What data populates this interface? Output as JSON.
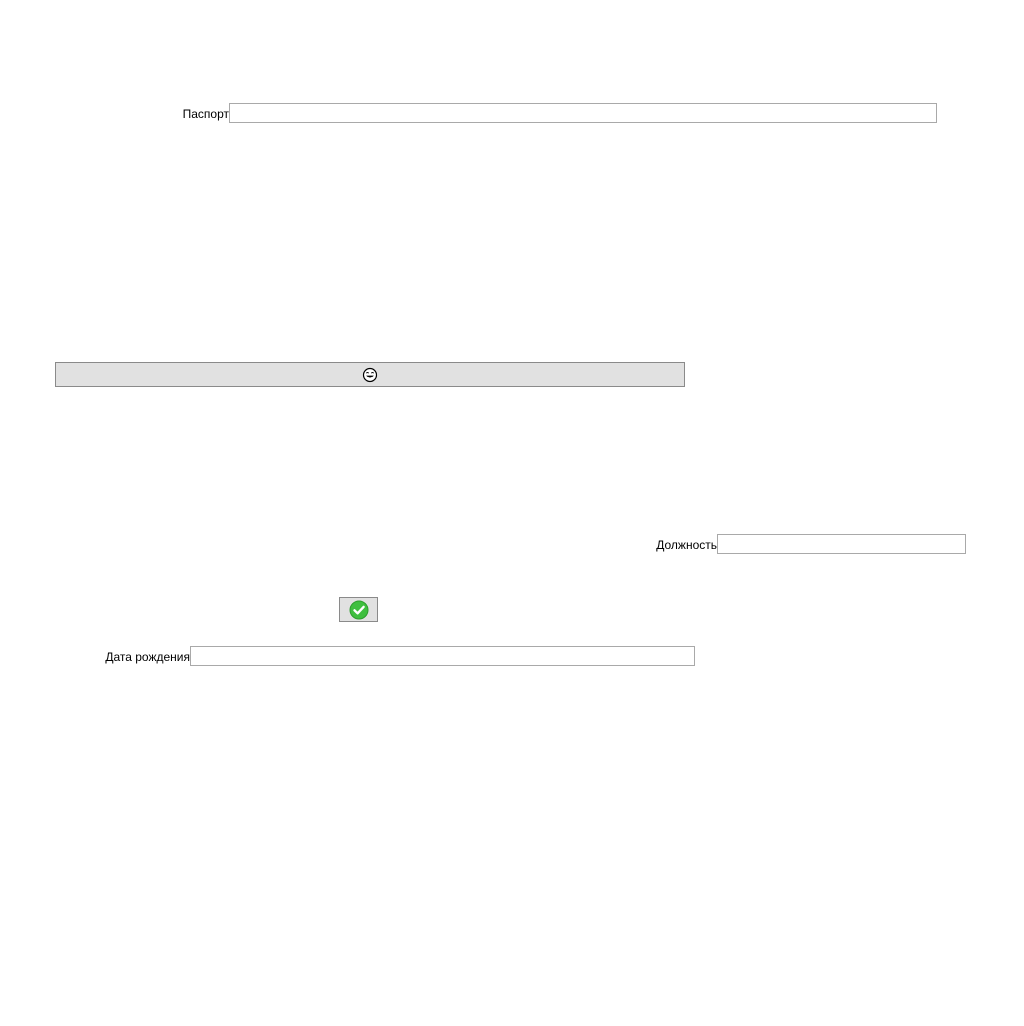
{
  "form": {
    "passport": {
      "label": "Паспорт",
      "value": ""
    },
    "position": {
      "label": "Должность",
      "value": ""
    },
    "birth_date": {
      "label": "Дата рождения",
      "value": ""
    }
  },
  "buttons": {
    "wide_button_icon": "laughing-face-icon",
    "confirm_button_icon": "checkmark-icon",
    "confirm_icon_color": "#3fbf3f"
  }
}
